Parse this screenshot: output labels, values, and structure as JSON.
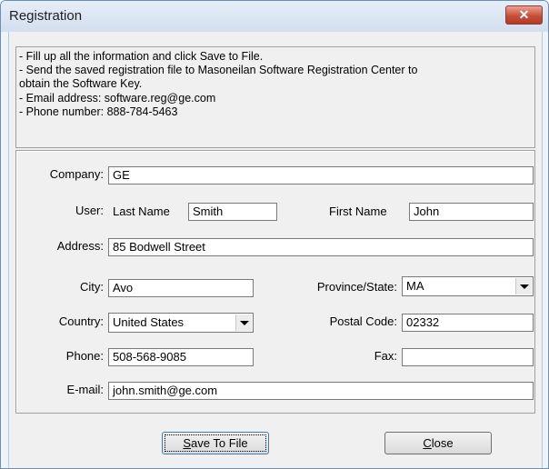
{
  "window": {
    "title": "Registration",
    "close_glyph": "✕"
  },
  "info": {
    "lines": [
      "- Fill up all the information and click Save to File.",
      "- Send the saved registration file to Masoneilan Software Registration Center to",
      "obtain the Software Key.",
      "- Email address: software.reg@ge.com",
      "- Phone number: 888-784-5463"
    ]
  },
  "form": {
    "company_label": "Company:",
    "company_value": "GE",
    "user_label": "User:",
    "last_name_label": "Last Name",
    "last_name_value": "Smith",
    "first_name_label": "First Name",
    "first_name_value": "John",
    "address_label": "Address:",
    "address_value": "85 Bodwell Street",
    "city_label": "City:",
    "city_value": "Avo",
    "province_label": "Province/State:",
    "province_value": "MA",
    "country_label": "Country:",
    "country_value": "United States",
    "postal_label": "Postal Code:",
    "postal_value": "02332",
    "phone_label": "Phone:",
    "phone_value": "508-568-9085",
    "fax_label": "Fax:",
    "fax_value": "",
    "email_label": "E-mail:",
    "email_value": "john.smith@ge.com"
  },
  "buttons": {
    "save_mnemonic": "S",
    "save_rest": "ave To File",
    "close_mnemonic": "C",
    "close_rest": "lose"
  }
}
